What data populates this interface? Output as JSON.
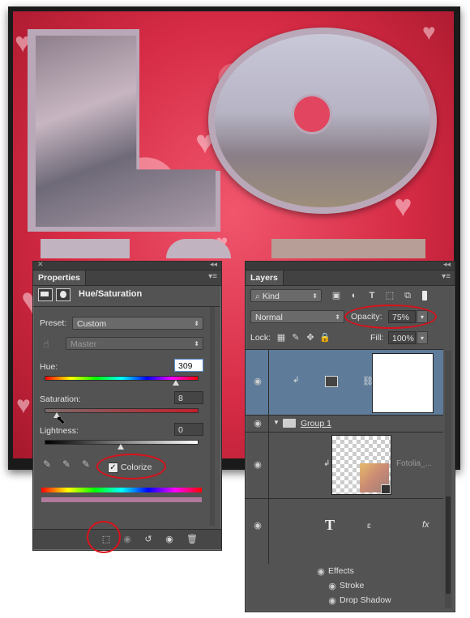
{
  "properties": {
    "tab_label": "Properties",
    "adjustment_title": "Hue/Saturation",
    "preset_label": "Preset:",
    "preset_value": "Custom",
    "channel_value": "Master",
    "hue_label": "Hue:",
    "hue_value": "309",
    "hue_level": 0.86,
    "saturation_label": "Saturation:",
    "saturation_value": "8",
    "saturation_level": 0.08,
    "lightness_label": "Lightness:",
    "lightness_value": "0",
    "lightness_level": 0.5,
    "colorize_label": "Colorize",
    "colorize_checked": true
  },
  "layers": {
    "tab_label": "Layers",
    "filter_kind": "Kind",
    "blend_mode": "Normal",
    "opacity_label": "Opacity:",
    "opacity_value": "75%",
    "lock_label": "Lock:",
    "fill_label": "Fill:",
    "fill_value": "100%",
    "group_name": "Group 1",
    "smart_object_name": "Fotolia_...",
    "effects_label": "Effects",
    "stroke_label": "Stroke",
    "drop_shadow_label": "Drop Shadow"
  },
  "colors": {
    "highlight_ring": "#d8121c",
    "selected_layer": "#5e7b99",
    "panel_bg": "#535353"
  }
}
